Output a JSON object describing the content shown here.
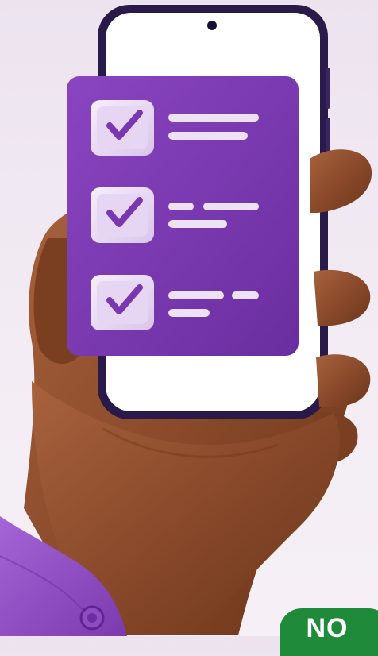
{
  "colors": {
    "background": "#efe7f1",
    "card": "#7a38b0",
    "checkbox": "#ece2f4",
    "checkmark": "#7a38b0",
    "phone_frame": "#2a1a4a",
    "skin": "#8a4a2a",
    "sleeve": "#8e4bc2",
    "badge": "#1f8a3a"
  },
  "checklist": {
    "items": [
      {
        "checked": true,
        "icon": "checkmark-icon"
      },
      {
        "checked": true,
        "icon": "checkmark-icon"
      },
      {
        "checked": true,
        "icon": "checkmark-icon"
      }
    ]
  },
  "badge": {
    "label": "NO"
  }
}
